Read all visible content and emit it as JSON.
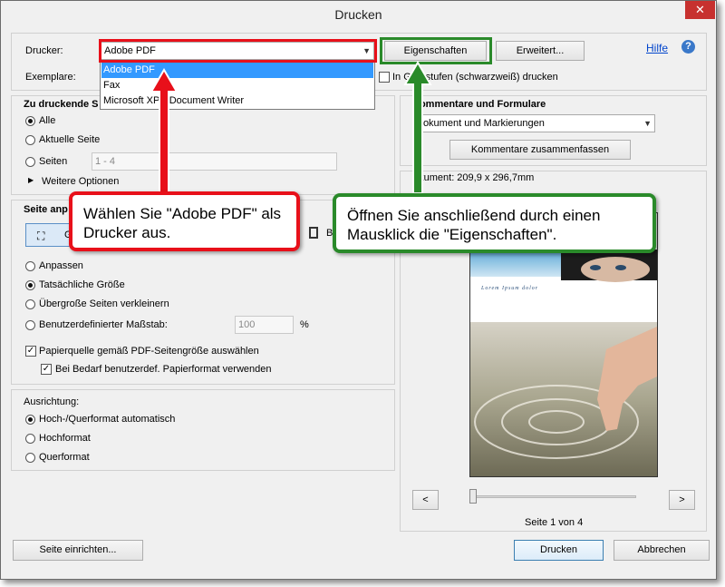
{
  "window": {
    "title": "Drucken",
    "close_glyph": "✕"
  },
  "printer": {
    "label": "Drucker:",
    "selected": "Adobe PDF",
    "properties_button": "Eigenschaften",
    "advanced_button": "Erweitert...",
    "help_link": "Hilfe",
    "help_glyph": "?",
    "options": [
      "Adobe PDF",
      "Fax",
      "Microsoft XPS Document Writer"
    ]
  },
  "copies": {
    "label": "Exemplare:",
    "grayscale_label": "In Graustufen (schwarzweiß) drucken"
  },
  "pages_to_print": {
    "heading": "Zu druckende S",
    "all": "Alle",
    "current": "Aktuelle Seite",
    "pages": "Seiten",
    "pages_value": "1 - 4",
    "more_options": "Weitere Optionen",
    "more_glyph": "▶"
  },
  "page_setup": {
    "heading": "Seite anp",
    "size_btn_partial": "G",
    "booklet_btn_partial": "B",
    "fit": "Anpassen",
    "actual": "Tatsächliche Größe",
    "shrink": "Übergroße Seiten verkleinern",
    "custom": "Benutzerdefinierter Maßstab:",
    "custom_value": "100",
    "percent": "%",
    "paper_source": "Papierquelle gemäß PDF-Seitengröße auswählen",
    "custom_paper": "Bei Bedarf benutzerdef. Papierformat verwenden",
    "check_glyph": "✓"
  },
  "orientation": {
    "heading": "Ausrichtung:",
    "auto": "Hoch-/Querformat automatisch",
    "portrait": "Hochformat",
    "landscape": "Querformat"
  },
  "comments": {
    "heading": "Kommentare und Formulare",
    "selected": "Dokument und Markierungen",
    "summarize_button": "Kommentare zusammenfassen"
  },
  "preview": {
    "document_size": "okument: 209,9 x 296,7mm",
    "page_text": "Lorem Ipsum dolor",
    "prev": "<",
    "next": ">",
    "page_indicator": "Seite 1 von 4"
  },
  "footer": {
    "page_setup_button": "Seite einrichten...",
    "print_button": "Drucken",
    "cancel_button": "Abbrechen"
  },
  "callouts": {
    "left": "Wählen Sie \"Adobe PDF\" als Drucker aus.",
    "right": "Öffnen Sie anschließend durch einen Mausklick die \"Eigenschaften\"."
  },
  "colors": {
    "red": "#e8101a",
    "green": "#2a8a2a",
    "accent": "#3399ff",
    "close": "#c7312f"
  }
}
